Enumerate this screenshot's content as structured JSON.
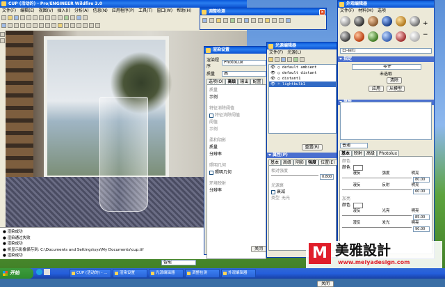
{
  "main_window": {
    "title": "CUP (活动的) - Pro/ENGINEER Wildfire 3.0",
    "menu": [
      "文件(F)",
      "编辑(E)",
      "视图(V)",
      "插入(I)",
      "分析(A)",
      "信息(N)",
      "应用程序(P)",
      "工具(T)",
      "窗口(W)",
      "帮助(H)"
    ]
  },
  "messages": [
    "渲染成功",
    "渲染通过失败",
    "渲染成功",
    "将显示影像保存到: C:\\Documents and Settings\\sys\\My Documents\\cup.tif",
    "渲染成功"
  ],
  "scene_dialog": {
    "title": "调整检测"
  },
  "render_settings": {
    "title": "渲染设置",
    "renderer_label": "渲染程序",
    "renderer_value": "PhotoLux",
    "quality_label": "质量",
    "quality_value": "高",
    "tabs": [
      "选项(O)",
      "高级",
      "输出",
      "配置"
    ],
    "quality_heading": "质量",
    "sample_label": "示例",
    "visibility_heading": "特征消除阈值",
    "visibility_check": "特征消除阈值",
    "sample_item1": "阈值",
    "sample_item2": "示例",
    "light_heading": "柔和阴影",
    "light_quality": "质量",
    "resolution": "分辨率",
    "camera_heading": "照明几何",
    "camera_check": "照明几何",
    "env_heading": "环境映射",
    "env_res": "分辨率",
    "close": "关闭"
  },
  "light_editor": {
    "title": "光源编辑器",
    "menu": [
      "文件(F)",
      "光源(L)"
    ],
    "lights": [
      "default ambient",
      "default distant",
      "distant1",
      "lightbulb1"
    ],
    "selected_index": 3,
    "reset_btn": "重置(R)",
    "properties_title": "属性(P)",
    "tabs": [
      "基本",
      "高级",
      "阴影",
      "强度",
      "位置(E)"
    ],
    "intensity_label": "相对强度",
    "intensity_value": "0.800",
    "distribution_label": "光源衰",
    "distribution_check": "衰减",
    "type_label": "类型",
    "type_value": "无光",
    "close": "关闭"
  },
  "appearance_editor": {
    "title": "外观编辑器",
    "menu": [
      "文件(F)",
      "材料(M)",
      "选项"
    ],
    "plus": "+",
    "minus": "−",
    "current_material": "白-自灯",
    "assign_section": "指定",
    "assign_value": "零件",
    "status": "未选取",
    "cancel_btn": "清除",
    "apply_btn": "应用",
    "from_model_btn": "从模型",
    "props_section": "属性",
    "material_type": "普通",
    "tabs": [
      "基本",
      "映射",
      "高级",
      "Photolux"
    ],
    "color_heading": "颜色",
    "color_label": "颜色",
    "ambient": "漫反",
    "intensity": "强度",
    "brightness": "明亮",
    "val1": "80.00",
    "env_label": "反射",
    "val2": "60.00",
    "highlight_heading": "加亮",
    "hl_color": "颜色",
    "hl_shine": "光亮",
    "hl_bright": "明亮",
    "hl_shininess": "发光",
    "val3": "85.00",
    "val4": "90.00"
  },
  "taskbar": {
    "start": "开始",
    "buttons": [
      "CUP (活动的) - ...",
      "渲染设置",
      "光源编辑器",
      "调整检测",
      "外观编辑器"
    ],
    "search_value": "智能"
  },
  "watermark": {
    "brand": "美雅設計",
    "url": "www.meiyadesign.com"
  },
  "colors": {
    "xp_blue": "#0a58d8",
    "panel": "#ece9d8",
    "selected": "#316ac5",
    "watermark_red": "#e01e2a"
  }
}
